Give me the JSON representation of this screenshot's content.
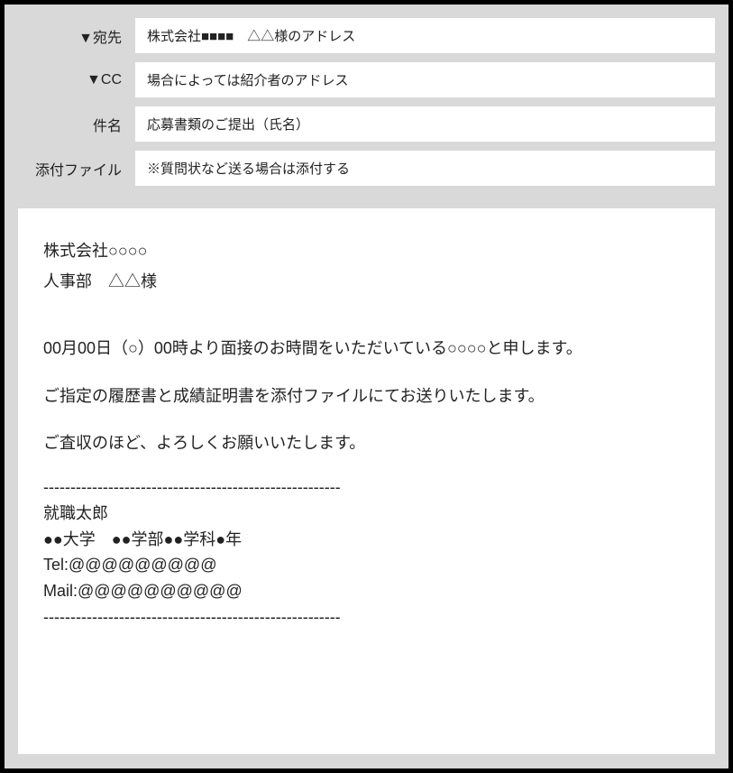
{
  "header": {
    "rows": [
      {
        "label": "▼宛先",
        "value": "株式会社■■■■　△△様のアドレス"
      },
      {
        "label": "▼CC",
        "value": "場合によっては紹介者のアドレス"
      },
      {
        "label": "件名",
        "value": "応募書類のご提出（氏名）"
      },
      {
        "label": "添付ファイル",
        "value": "※質問状など送る場合は添付する"
      }
    ]
  },
  "body": {
    "recipient_company": "株式会社○○○○",
    "recipient_person": "人事部　△△様",
    "para1": "00月00日（○）00時より面接のお時間をいただいている○○○○と申します。",
    "para2": "ご指定の履歴書と成績証明書を添付ファイルにてお送りいたします。",
    "para3": "ご査収のほど、よろしくお願いいたします。"
  },
  "signature": {
    "divider": "-------------------------------------------------------",
    "name": "就職太郎",
    "school": "●●大学　●●学部●●学科●年",
    "tel": "Tel:@@@@@@@@@",
    "mail": "Mail:@@@@@@@@@@"
  }
}
